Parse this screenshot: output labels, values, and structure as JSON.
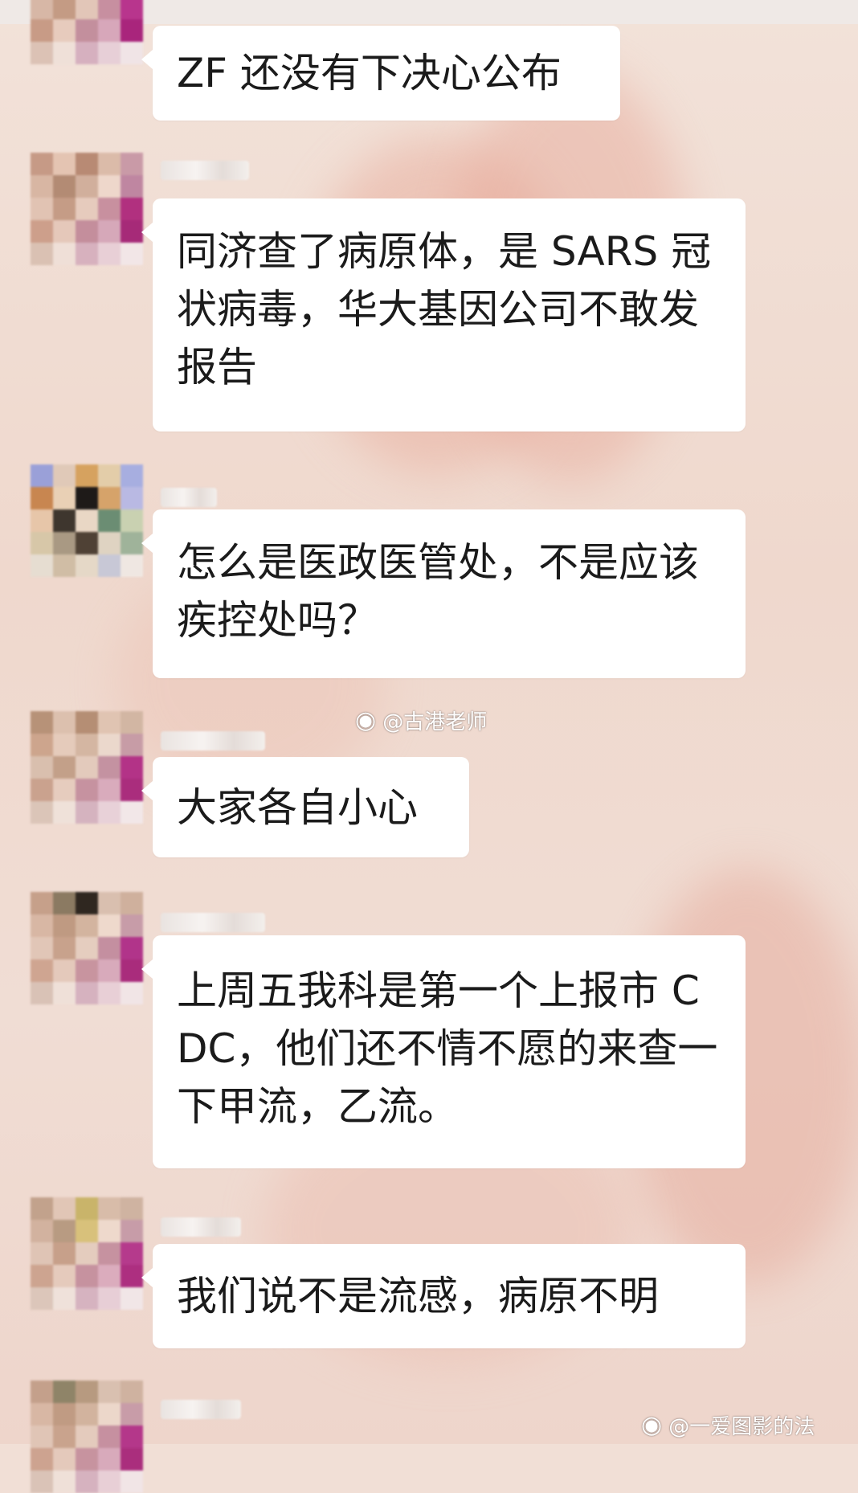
{
  "messages": [
    {
      "text": "ZF 还没有下决心公布"
    },
    {
      "text": "同济查了病原体，是 SARS 冠状病毒，华大基因公司不敢发报告"
    },
    {
      "text": "怎么是医政医管处，不是应该疾控处吗？"
    },
    {
      "text": "大家各自小心"
    },
    {
      "text": "上周五我科是第一个上报市 CDC，他们还不情不愿的来查一下甲流，乙流。"
    },
    {
      "text": "我们说不是流感，病原不明"
    }
  ],
  "watermarks": {
    "center": "@古港老师",
    "bottom_right": "@一爱图影的法"
  },
  "icons": {
    "watermark_icon": "weibo-icon"
  },
  "colors": {
    "bubble": "#ffffff",
    "background": "#f1dfd6",
    "text": "#1b1b1b"
  }
}
